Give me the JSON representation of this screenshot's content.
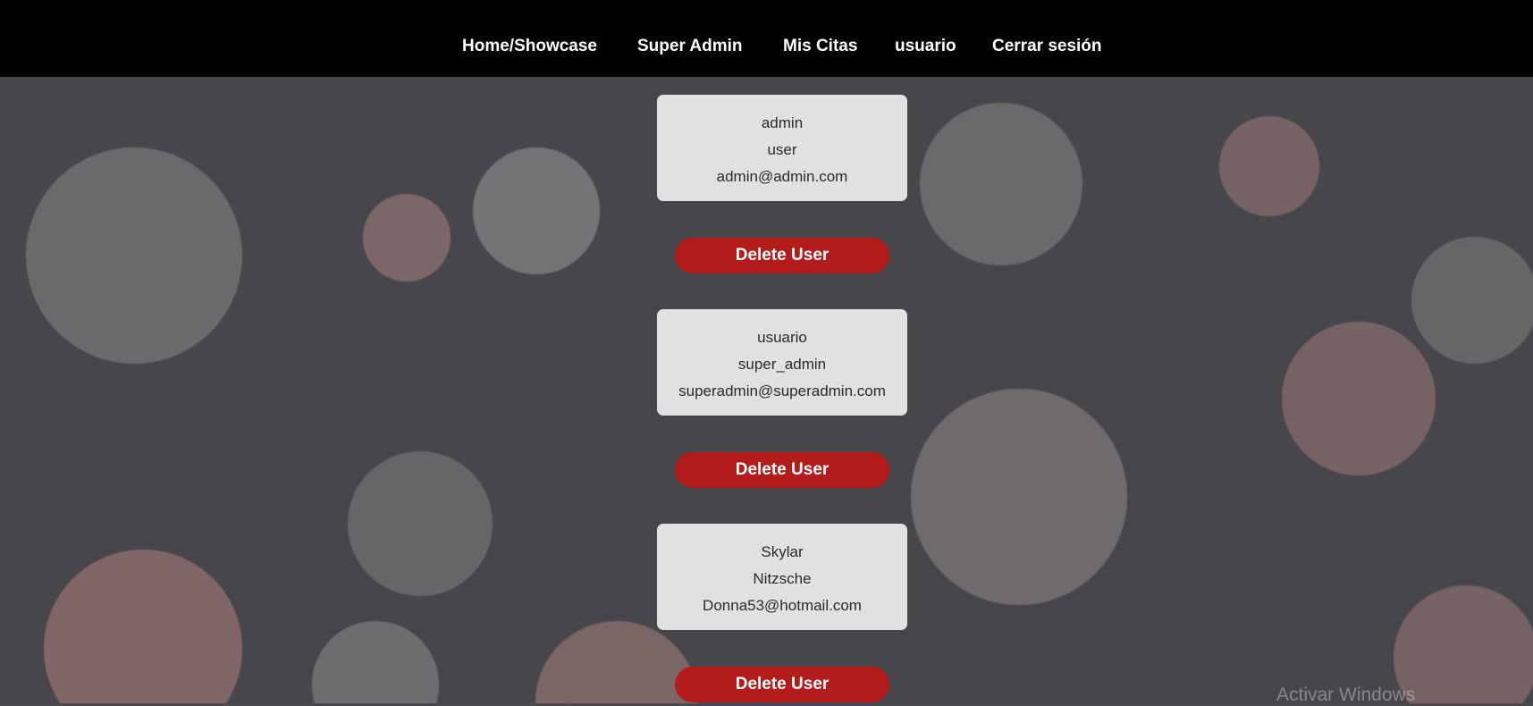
{
  "nav": {
    "items": [
      {
        "label": "Home/Showcase"
      },
      {
        "label": "Super Admin"
      },
      {
        "label": "Mis Citas"
      },
      {
        "label": "usuario"
      },
      {
        "label": "Cerrar sesión"
      }
    ]
  },
  "users": [
    {
      "name": "admin",
      "role": "user",
      "email": "admin@admin.com",
      "delete_label": "Delete User"
    },
    {
      "name": "usuario",
      "role": "super_admin",
      "email": "superadmin@superadmin.com",
      "delete_label": "Delete User"
    },
    {
      "name": "Skylar",
      "role": "Nitzsche",
      "email": "Donna53@hotmail.com",
      "delete_label": "Delete User"
    }
  ],
  "watermark": "Activar Windows",
  "colors": {
    "nav_background": "#000000",
    "card_background": "#e1e1e1",
    "delete_button": "#b41c1c"
  }
}
